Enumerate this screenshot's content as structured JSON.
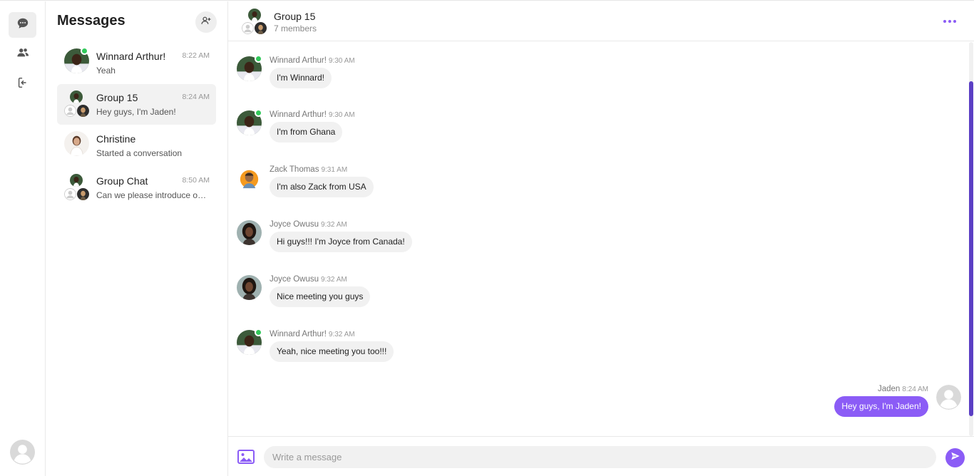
{
  "accent_color": "#8b5cf6",
  "online_color": "#31c85a",
  "rail": {
    "items": [
      {
        "icon": "chat-bubble-icon",
        "active": true
      },
      {
        "icon": "users-icon",
        "active": false
      },
      {
        "icon": "logout-icon",
        "active": false
      }
    ],
    "user_avatar": "default-user-avatar"
  },
  "sidebar": {
    "title": "Messages",
    "add_user_icon": "add-user-icon",
    "conversations": [
      {
        "name": "Winnard Arthur!",
        "time": "8:22 AM",
        "preview": "Yeah",
        "online": true,
        "active": false
      },
      {
        "name": "Group 15",
        "time": "8:24 AM",
        "preview": "Hey guys, I'm Jaden!",
        "active": true
      },
      {
        "name": "Christine",
        "time": "",
        "preview": "Started a conversation",
        "active": false
      },
      {
        "name": "Group Chat",
        "time": "8:50 AM",
        "preview": "Can we please introduce ourselves",
        "active": false
      }
    ]
  },
  "chat": {
    "title": "Group 15",
    "subtitle": "7 members",
    "more_icon": "more-dots-icon",
    "messages": [
      {
        "sender": "Winnard Arthur!",
        "time": "9:30 AM",
        "text": "I'm Winnard!",
        "online": true
      },
      {
        "sender": "Winnard Arthur!",
        "time": "9:30 AM",
        "text": "I'm from Ghana",
        "online": true
      },
      {
        "sender": "Zack Thomas",
        "time": "9:31 AM",
        "text": "I'm also Zack from USA",
        "online": false
      },
      {
        "sender": "Joyce Owusu",
        "time": "9:32 AM",
        "text": "Hi guys!!! I'm Joyce from Canada!",
        "online": false
      },
      {
        "sender": "Joyce Owusu",
        "time": "9:32 AM",
        "text": "Nice meeting you guys",
        "online": false
      },
      {
        "sender": "Winnard Arthur!",
        "time": "9:32 AM",
        "text": "Yeah, nice meeting you too!!!",
        "online": true
      }
    ],
    "outgoing": {
      "sender": "Jaden",
      "time": "8:24 AM",
      "text": "Hey guys, I'm Jaden!"
    }
  },
  "composer": {
    "placeholder": "Write a message",
    "image_icon": "image-icon",
    "send_icon": "send-icon"
  }
}
